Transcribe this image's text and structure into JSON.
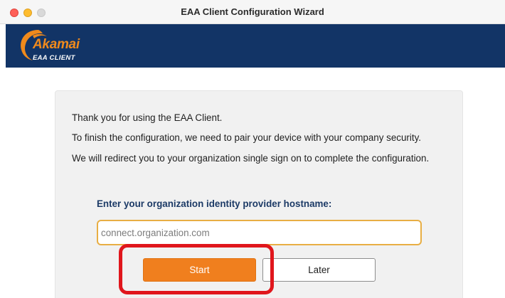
{
  "window": {
    "title": "EAA Client Configuration Wizard"
  },
  "header": {
    "logo_word": "Akamai",
    "logo_subtitle": "EAA CLIENT",
    "background_color": "#123466",
    "logo_color": "#f08a1c"
  },
  "content": {
    "intro_lines": [
      "Thank you for using the EAA Client.",
      "To finish the configuration, we need to pair your device with your company security.",
      "We will redirect you to your organization single sign on to complete the configuration."
    ],
    "hostname_label": "Enter your organization identity provider hostname:",
    "hostname_value": "",
    "hostname_placeholder": "connect.organization.com"
  },
  "actions": {
    "start_label": "Start",
    "later_label": "Later",
    "start_color": "#f07f1e"
  },
  "annotation": {
    "highlight_color": "#e0161c"
  }
}
